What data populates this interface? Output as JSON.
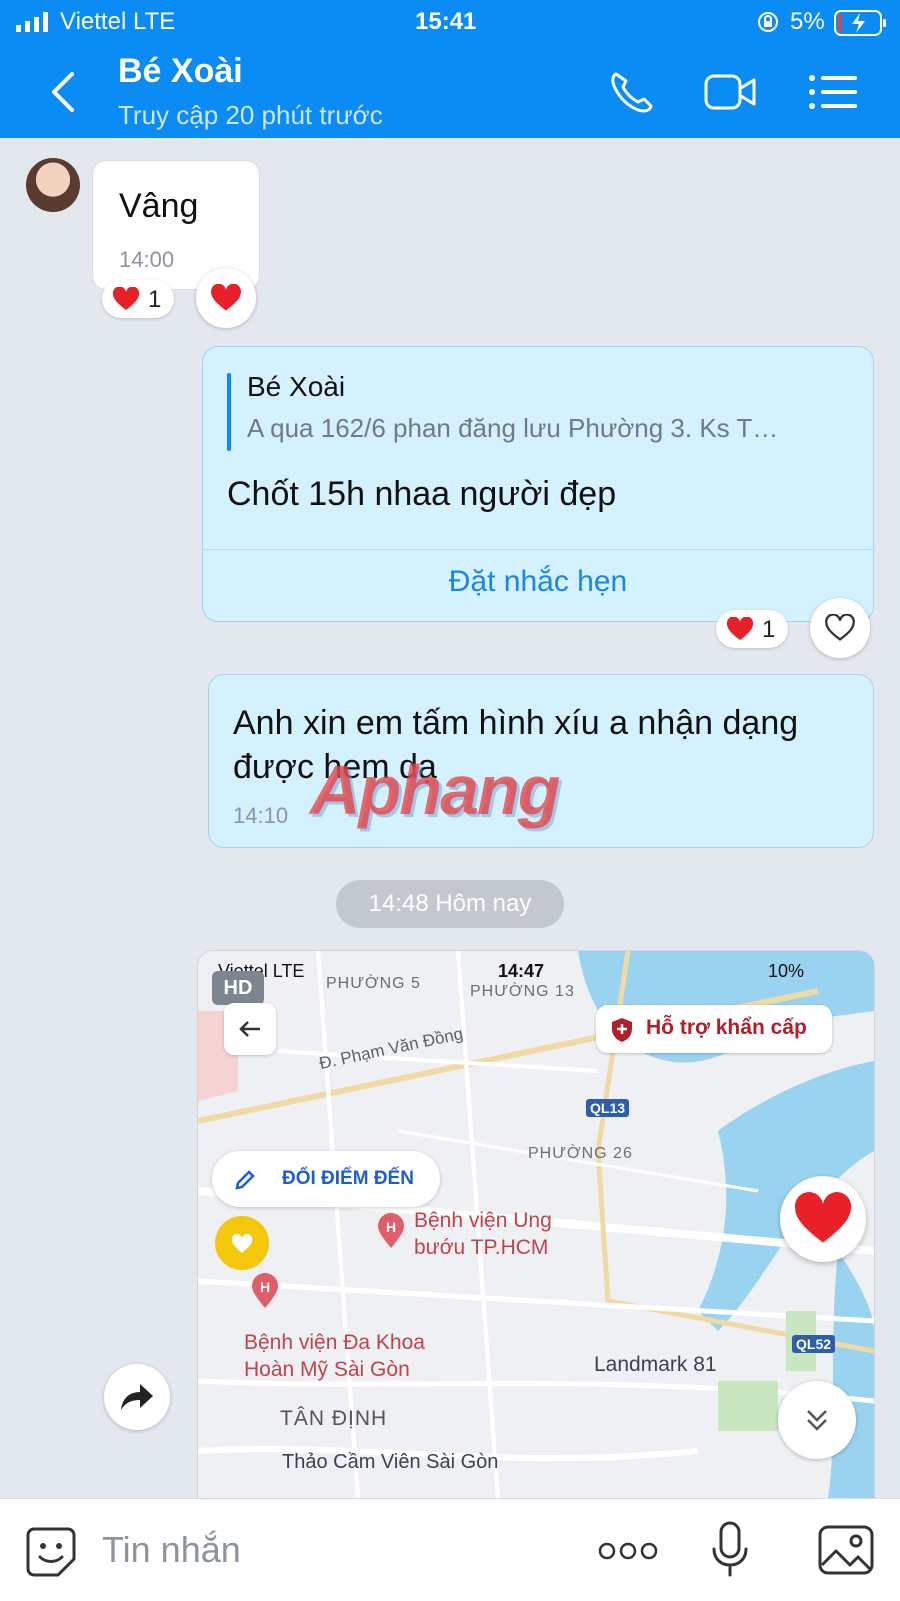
{
  "status_bar": {
    "carrier": "Viettel  LTE",
    "time": "15:41",
    "battery": "5%"
  },
  "header": {
    "title": "Bé Xoài",
    "subtitle": "Truy cập 20 phút trước",
    "icons": [
      "back-icon",
      "phone-icon",
      "video-icon",
      "menu-icon"
    ]
  },
  "messages": {
    "incoming_1": {
      "text": "Vâng",
      "time": "14:00",
      "reaction_count": "1"
    },
    "outgoing_1": {
      "quote_name": "Bé Xoài",
      "quote_text": "A qua 162/6 phan đăng lưu Phường 3. Ks T…",
      "text": "Chốt 15h nhaa người đẹp",
      "action": "Đặt nhắc hẹn",
      "reaction_count": "1"
    },
    "outgoing_2": {
      "text": "Anh xin em tấm hình xíu a nhận dạng được hem dạ",
      "time": "14:10"
    },
    "watermark": "Aphang",
    "date_divider": "14:48 Hôm nay"
  },
  "map_image": {
    "status_carrier": "Viettel  LTE",
    "status_time": "14:47",
    "status_battery": "10%",
    "hd_badge": "HD",
    "sos_label": "Hỗ trợ khẩn cấp",
    "change_dest_label": "ĐỔI ĐIỂM ĐẾN",
    "labels": {
      "phuong5": "PHƯỜNG 5",
      "phuong13": "PHƯỜNG 13",
      "phuong26": "PHƯỜNG 26",
      "tan_dinh": "TÂN ĐỊNH",
      "road_pvd": "Đ. Phạm Văn Đồng",
      "ql13": "QL13",
      "ql52": "QL52",
      "hosp1": "Bệnh viện Ung\nbướu TP.HCM",
      "hosp2": "Bệnh viện Đa Khoa\nHoàn Mỹ Sài Gòn",
      "landmark": "Landmark 81",
      "zoo": "Thảo Cầm Viên Sài Gòn"
    }
  },
  "input": {
    "placeholder": "Tin nhắn"
  },
  "colors": {
    "header": "#0b8cf5",
    "bubble_out": "#d4f1ff",
    "chat_bg": "#e3e8ef",
    "heart": "#e8202a"
  }
}
